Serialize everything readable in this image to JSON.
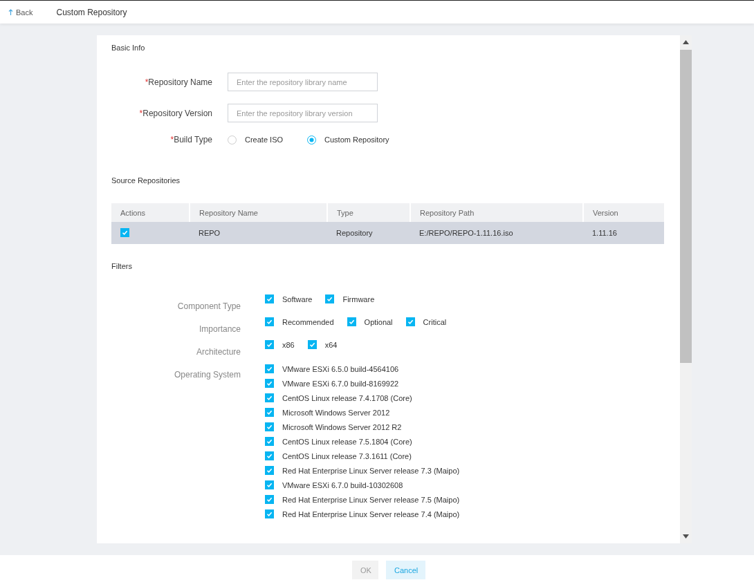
{
  "header": {
    "back_label": "Back",
    "title": "Custom Repository"
  },
  "basic_info": {
    "title": "Basic Info",
    "fields": [
      {
        "label": "Repository Name",
        "required_mark": "*",
        "placeholder": "Enter the repository library name"
      },
      {
        "label": "Repository Version",
        "required_mark": "*",
        "placeholder": "Enter the repository library version"
      }
    ],
    "build_type": {
      "label": "Build Type",
      "required_mark": "*",
      "options": [
        {
          "label": "Create ISO",
          "selected": false
        },
        {
          "label": "Custom Repository",
          "selected": true
        }
      ]
    }
  },
  "source_repositories": {
    "title": "Source Repositories",
    "columns": [
      "Actions",
      "Repository Name",
      "Type",
      "Repository Path",
      "Version"
    ],
    "rows": [
      {
        "checked": true,
        "selected": true,
        "cells": [
          "",
          "REPO",
          "Repository",
          "E:/REPO/REPO-1.11.16.iso",
          "1.11.16"
        ]
      }
    ]
  },
  "filters": {
    "title": "Filters",
    "groups": [
      {
        "label": "Component Type",
        "kind": "inline",
        "options": [
          {
            "label": "Software",
            "checked": true
          },
          {
            "label": "Firmware",
            "checked": true
          }
        ]
      },
      {
        "label": "Importance",
        "kind": "inline",
        "options": [
          {
            "label": "Recommended",
            "checked": true
          },
          {
            "label": "Optional",
            "checked": true
          },
          {
            "label": "Critical",
            "checked": true
          }
        ]
      },
      {
        "label": "Architecture",
        "kind": "inline",
        "options": [
          {
            "label": "x86",
            "checked": true
          },
          {
            "label": "x64",
            "checked": true
          }
        ]
      },
      {
        "label": "Operating System",
        "kind": "list",
        "options": [
          {
            "label": "VMware ESXi 6.5.0 build-4564106",
            "checked": true
          },
          {
            "label": "VMware ESXi 6.7.0 build-8169922",
            "checked": true
          },
          {
            "label": "CentOS Linux release 7.4.1708 (Core)",
            "checked": true
          },
          {
            "label": "Microsoft Windows Server 2012",
            "checked": true
          },
          {
            "label": "Microsoft Windows Server 2012 R2",
            "checked": true
          },
          {
            "label": "CentOS Linux release 7.5.1804 (Core)",
            "checked": true
          },
          {
            "label": "CentOS Linux release 7.3.1611 (Core)",
            "checked": true
          },
          {
            "label": "Red Hat Enterprise Linux Server release 7.3 (Maipo)",
            "checked": true
          },
          {
            "label": "VMware ESXi 6.7.0 build-10302608",
            "checked": true
          },
          {
            "label": "Red Hat Enterprise Linux Server release 7.5 (Maipo)",
            "checked": true
          },
          {
            "label": "Red Hat Enterprise Linux Server release 7.4 (Maipo)",
            "checked": true
          }
        ]
      }
    ]
  },
  "footer": {
    "buttons": [
      {
        "label": "OK",
        "disabled": true
      },
      {
        "label": "Cancel",
        "disabled": false
      }
    ]
  }
}
